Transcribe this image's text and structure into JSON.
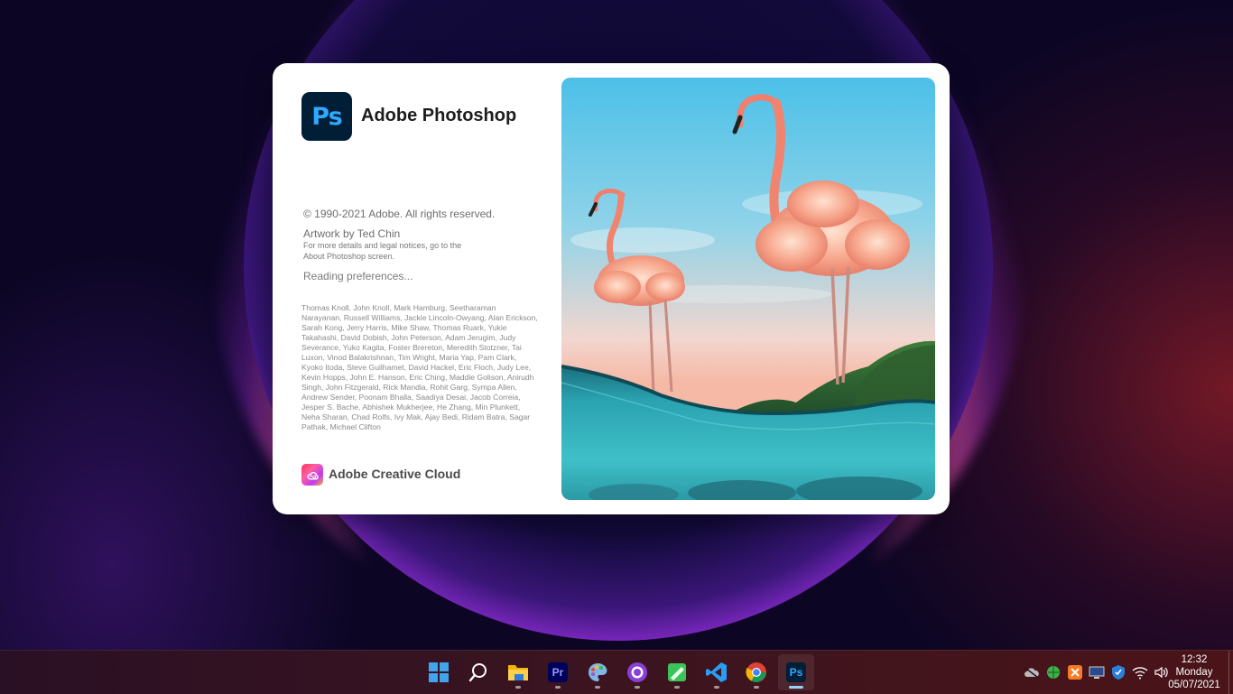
{
  "splash": {
    "logo_text": "Ps",
    "title": "Adobe Photoshop",
    "copyright": "© 1990-2021 Adobe. All rights reserved.",
    "artwork_credit": "Artwork by Ted Chin",
    "legal_line1": "For more details and legal notices, go to the",
    "legal_line2": "About Photoshop screen.",
    "status": "Reading preferences...",
    "credits": "Thomas Knoll, John Knoll, Mark Hamburg, Seetharaman Narayanan, Russell Williams, Jackie Lincoln-Owyang, Alan Erickson, Sarah Kong, Jerry Harris, Mike Shaw, Thomas Ruark, Yukie Takahashi, David Dobish, John Peterson, Adam Jerugim, Judy Severance, Yuko Kagita, Foster Brereton, Meredith Stotzner, Tai Luxon, Vinod Balakrishnan, Tim Wright, Maria Yap, Pam Clark, Kyoko Itoda, Steve Guilhamet, David Hackel, Eric Floch, Judy Lee, Kevin Hopps, John E. Hanson, Eric Ching, Maddie Golison, Anirudh Singh, John Fitzgerald, Rick Mandia, Rohit Garg, Sympa Allen, Andrew Sender, Poonam Bhalla, Saadiya Desai, Jacob Correia, Jesper S. Bache, Abhishek Mukherjee, He Zhang, Min Plunkett, Neha Sharan, Chad Rolfs, Ivy Mak, Ajay Bedi, Ridam Batra, Sagar Pathak, Michael Clifton",
    "cc_label": "Adobe Creative Cloud"
  },
  "taskbar": {
    "items": [
      {
        "name": "start",
        "icon": "windows-logo-icon"
      },
      {
        "name": "search",
        "icon": "search-icon"
      },
      {
        "name": "file-explorer",
        "icon": "folder-icon"
      },
      {
        "name": "premiere-pro",
        "icon": "premiere-pro-icon",
        "label": "Pr"
      },
      {
        "name": "paint",
        "icon": "paint-palette-icon"
      },
      {
        "name": "github-desktop",
        "icon": "github-icon"
      },
      {
        "name": "notepad-plus",
        "icon": "green-notepad-icon"
      },
      {
        "name": "vscode",
        "icon": "vscode-icon"
      },
      {
        "name": "chrome",
        "icon": "chrome-icon"
      },
      {
        "name": "photoshop",
        "icon": "photoshop-icon",
        "label": "Ps"
      }
    ],
    "clock": {
      "time": "12:32",
      "day": "Monday",
      "date": "05/07/2021"
    }
  },
  "colors": {
    "ps_bg": "#001e36",
    "ps_text": "#31a8ff",
    "pr_bg": "#00005b",
    "pr_text": "#9999ff"
  }
}
